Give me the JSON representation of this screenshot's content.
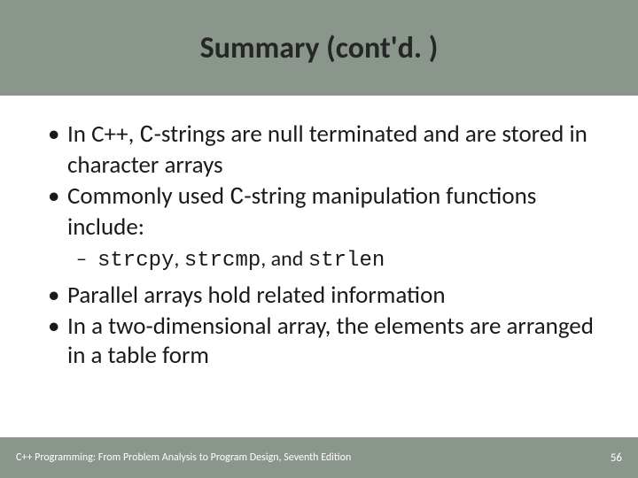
{
  "title": "Summary (cont'd. )",
  "bullets": {
    "b1_pre": "In C++, ",
    "b1_mono": "C",
    "b1_post": "-strings are null terminated and are stored in character arrays",
    "b2_pre": "Commonly used ",
    "b2_mono": "C",
    "b2_post": "-string manipulation functions include:",
    "sub1_m1": "strcpy",
    "sub1_t1": ", ",
    "sub1_m2": "strcmp",
    "sub1_t2": ", and ",
    "sub1_m3": "strlen",
    "b3": "Parallel arrays hold related information",
    "b4": "In a two-dimensional array, the elements are arranged in a table form"
  },
  "footer": {
    "left": "C++ Programming: From Problem Analysis to Program Design, Seventh Edition",
    "page": "56"
  }
}
